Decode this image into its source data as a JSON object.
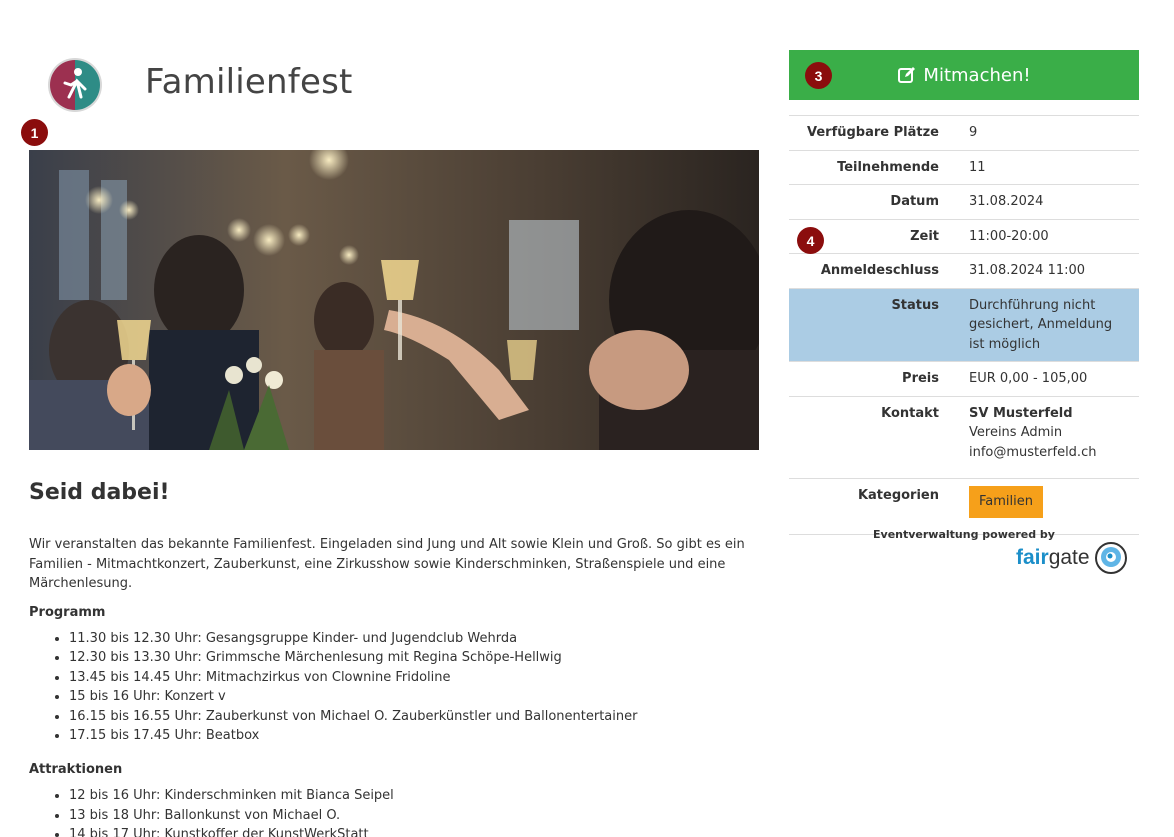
{
  "header": {
    "title": "Familienfest"
  },
  "markers": [
    "1",
    "3",
    "4"
  ],
  "hero": {
    "icon": "celebration-photo"
  },
  "main": {
    "heading": "Seid dabei!",
    "intro": "Wir veranstalten das bekannte Familienfest. Eingeladen sind Jung und Alt sowie Klein und Groß. So gibt es ein Familien - Mitmachtkonzert, Zauberkunst, eine Zirkusshow sowie Kinderschminken, Straßenspiele und eine Märchenlesung.",
    "programm_heading": "Programm",
    "programm": [
      "11.30 bis 12.30 Uhr: Gesangsgruppe Kinder- und Jugendclub Wehrda",
      "12.30 bis 13.30 Uhr: Grimmsche Märchenlesung mit Regina Schöpe-Hellwig",
      "13.45 bis 14.45 Uhr: Mitmachzirkus von Clownine Fridoline",
      "15 bis 16 Uhr: Konzert v",
      "16.15 bis 16.55 Uhr: Zauberkunst von Michael O. Zauberkünstler und Ballonentertainer",
      "17.15 bis 17.45 Uhr: Beatbox"
    ],
    "attraktionen_heading": "Attraktionen",
    "attraktionen": [
      "12 bis 16 Uhr: Kinderschminken mit Bianca Seipel",
      "13 bis 18 Uhr: Ballonkunst von Michael O.",
      "14 bis 17 Uhr: Kunstkoffer der KunstWerkStatt"
    ]
  },
  "sidebar": {
    "signup_label": "Mitmachen!",
    "signup_color": "#3aae48",
    "details": {
      "plaetze_label": "Verfügbare Plätze",
      "plaetze_value": "9",
      "teilnehmende_label": "Teilnehmende",
      "teilnehmende_value": "11",
      "datum_label": "Datum",
      "datum_value": "31.08.2024",
      "zeit_label": "Zeit",
      "zeit_value": "11:00-20:00",
      "anmeldeschluss_label": "Anmeldeschluss",
      "anmeldeschluss_value": "31.08.2024 11:00",
      "status_label": "Status",
      "status_value": "Durchführung nicht gesichert, Anmeldung ist möglich",
      "status_color": "#abcce4",
      "preis_label": "Preis",
      "preis_value": "EUR 0,00 - 105,00",
      "kontakt_label": "Kontakt",
      "kontakt_name": "SV Musterfeld",
      "kontakt_person": "Vereins Admin",
      "kontakt_email": "info@musterfeld.ch",
      "kategorien_label": "Kategorien",
      "kategorie": "Familien",
      "kategorie_color": "#f6a01a"
    },
    "powered_by": "Eventverwaltung powered by",
    "brand_fair": "fair",
    "brand_gate": "gate"
  }
}
